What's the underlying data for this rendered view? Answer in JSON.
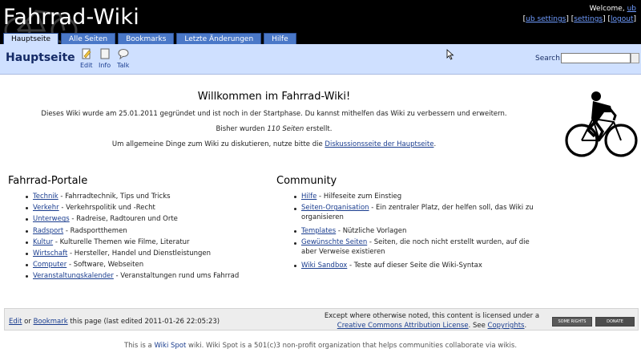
{
  "site": {
    "title": "Fahrrad-Wiki",
    "welcome_prefix": "Welcome,",
    "username": "ub",
    "user_links": [
      "ub settings",
      "settings",
      "logout"
    ]
  },
  "tabs": [
    {
      "label": "Hauptseite",
      "active": true
    },
    {
      "label": "Alle Seiten",
      "active": false
    },
    {
      "label": "Bookmarks",
      "active": false
    },
    {
      "label": "Letzte Änderungen",
      "active": false
    },
    {
      "label": "Hilfe",
      "active": false
    }
  ],
  "page": {
    "title": "Hauptseite",
    "tools": [
      {
        "label": "Edit",
        "icon": "edit-icon"
      },
      {
        "label": "Info",
        "icon": "info-icon"
      },
      {
        "label": "Talk",
        "icon": "talk-icon"
      }
    ],
    "search_label": "Search:",
    "search_value": ""
  },
  "intro": {
    "heading": "Willkommen im Fahrrad-Wiki!",
    "line1": "Dieses Wiki wurde am 25.01.2011 gegründet und ist noch in der Startphase. Du kannst mithelfen das Wiki zu verbessern und erweitern.",
    "line2_prefix": "Bisher wurden ",
    "line2_count": "110 Seiten",
    "line2_suffix": " erstellt.",
    "line3_prefix": "Um allgemeine Dinge zum Wiki zu diskutieren, nutze bitte die ",
    "line3_link": "Diskussionsseite der Hauptseite",
    "line3_suffix": "."
  },
  "portals": {
    "heading": "Fahrrad-Portale",
    "items": [
      {
        "link": "Technik",
        "text": " - Fahrradtechnik, Tips und Tricks"
      },
      {
        "link": "Verkehr",
        "text": " - Verkehrspolitik und -Recht"
      },
      {
        "link": "Unterwegs",
        "text": " - Radreise, Radtouren und Orte"
      },
      {
        "link": "Radsport",
        "text": " - Radsportthemen"
      },
      {
        "link": "Kultur",
        "text": " - Kulturelle Themen wie Filme, Literatur"
      },
      {
        "link": "Wirtschaft",
        "text": " - Hersteller, Handel und Dienstleistungen"
      },
      {
        "link": "Computer",
        "text": " - Software, Webseiten"
      },
      {
        "link": "Veranstaltungskalender",
        "text": " - Veranstaltungen rund ums Fahrrad"
      }
    ]
  },
  "community": {
    "heading": "Community",
    "items": [
      {
        "link": "Hilfe",
        "text": " - Hilfeseite zum Einstieg"
      },
      {
        "link": "Seiten-Organisation",
        "text": " - Ein zentraler Platz, der helfen soll, das Wiki zu organisieren"
      },
      {
        "link": "Templates",
        "text": " - Nützliche Vorlagen"
      },
      {
        "link": "Gewünschte Seiten",
        "text": " - Seiten, die noch nicht erstellt wurden, auf die aber Verweise existieren"
      },
      {
        "link": "Wiki Sandbox",
        "text": " - Teste auf dieser Seite die Wiki-Syntax"
      }
    ]
  },
  "footer": {
    "edit_link": "Edit",
    "or_text": " or ",
    "bookmark_link": "Bookmark",
    "info_text": " this page (last edited 2011-01-26 22:05:23)",
    "license_prefix": "Except where otherwise noted, this content is licensed under a",
    "license_link": "Creative Commons Attribution License",
    "license_mid": ". See ",
    "copyrights_link": "Copyrights",
    "license_end": ".",
    "badge1": "SOME RIGHTS",
    "badge2": "DONATE"
  },
  "bottom": {
    "prefix": "This is a ",
    "link": "Wiki Spot",
    "suffix": " wiki. Wiki Spot is a 501(c)3 non-profit organization that helps communities collaborate via wikis."
  },
  "colors": {
    "header_bg": "#000000",
    "tab_bg": "#4a78c8",
    "titlebar_bg": "#cfe0ff",
    "link": "#1a3d8f"
  }
}
